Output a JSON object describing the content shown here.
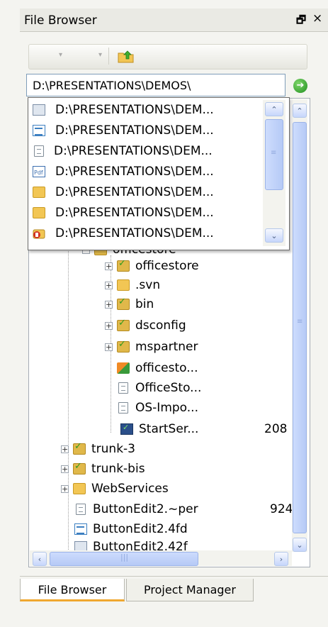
{
  "title": "File Browser",
  "window_controls": {
    "float": "🗗",
    "close": "×"
  },
  "toolbar": {
    "back_arrow": "▾",
    "forward_arrow": "▾"
  },
  "path_input": {
    "value": "D:\\PRESENTATIONS\\DEMOS\\"
  },
  "dropdown": {
    "items": [
      {
        "icon": "gear-file-icon",
        "label": "D:\\PRESENTATIONS\\DEM..."
      },
      {
        "icon": "form-file-icon",
        "label": "D:\\PRESENTATIONS\\DEM..."
      },
      {
        "icon": "document-icon",
        "label": "D:\\PRESENTATIONS\\DEM..."
      },
      {
        "icon": "pdf-file-icon",
        "label": "D:\\PRESENTATIONS\\DEM..."
      },
      {
        "icon": "folder-icon",
        "label": "D:\\PRESENTATIONS\\DEM..."
      },
      {
        "icon": "folder-icon",
        "label": "D:\\PRESENTATIONS\\DEM..."
      },
      {
        "icon": "office-icon",
        "label": "D:\\PRESENTATIONS\\DEM..."
      }
    ],
    "scroll_up": "⌃",
    "scroll_down": "⌄",
    "scroll_grip": "≡"
  },
  "tree": {
    "partial_label": "officestore",
    "rows": [
      {
        "label": "officestore",
        "icon": "versioned-folder-icon",
        "expander": "+"
      },
      {
        "label": ".svn",
        "icon": "folder-icon",
        "expander": "+"
      },
      {
        "label": "bin",
        "icon": "versioned-folder-icon",
        "expander": "+"
      },
      {
        "label": "dsconfig",
        "icon": "versioned-folder-icon",
        "expander": "+"
      },
      {
        "label": "mspartner",
        "icon": "versioned-folder-icon",
        "expander": "+"
      },
      {
        "label": "officesto...",
        "icon": "project-icon",
        "expander": ""
      },
      {
        "label": "OfficeSto...",
        "icon": "document-icon",
        "expander": ""
      },
      {
        "label": "OS-Impo...",
        "icon": "document-icon",
        "expander": ""
      },
      {
        "label": "StartSer...",
        "icon": "executable-icon",
        "expander": "",
        "size": "208"
      },
      {
        "label": "trunk-3",
        "icon": "versioned-folder-icon",
        "expander": "+"
      },
      {
        "label": "trunk-bis",
        "icon": "versioned-folder-icon",
        "expander": "+"
      },
      {
        "label": "WebServices",
        "icon": "folder-icon",
        "expander": "+"
      },
      {
        "label": "ButtonEdit2.~per",
        "icon": "document-icon",
        "expander": "",
        "size": "924"
      },
      {
        "label": "ButtonEdit2.4fd",
        "icon": "form-file-icon",
        "expander": ""
      },
      {
        "label": "ButtonEdit2.42f",
        "icon": "gear-file-icon",
        "expander": ""
      }
    ]
  },
  "scrollbar": {
    "up": "⌃",
    "down": "⌄",
    "left": "‹",
    "right": "›",
    "grip_v": "≡",
    "grip_h": "|||"
  },
  "tabs": [
    {
      "label": "File Browser",
      "active": true
    },
    {
      "label": "Project Manager",
      "active": false
    }
  ],
  "colors": {
    "accent_tab": "#f0a830",
    "scrollbar": "#c6d6fb",
    "folder": "#f2c654",
    "go_button": "#1f8f1f"
  }
}
